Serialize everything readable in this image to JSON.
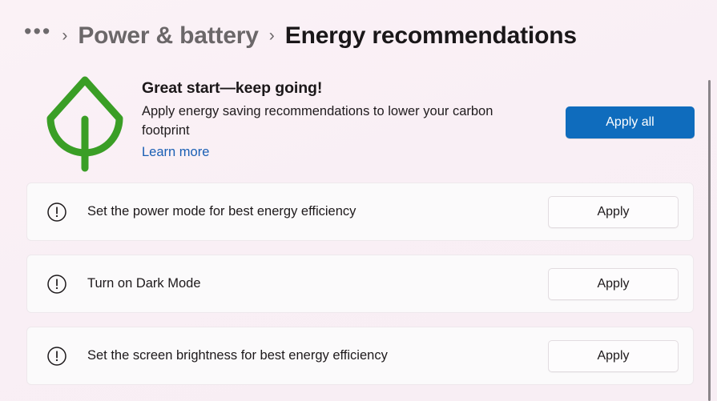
{
  "breadcrumb": {
    "overflow_label": "•••",
    "separator": "›",
    "parent_label": "Power & battery",
    "current_label": "Energy recommendations"
  },
  "hero": {
    "icon": "leaf-icon",
    "icon_color": "#3a9e26",
    "title": "Great start—keep going!",
    "description": "Apply energy saving recommendations to lower your carbon footprint",
    "link_label": "Learn more",
    "link_color": "#1a5fb4",
    "apply_all_label": "Apply all",
    "apply_all_color": "#0f6cbd"
  },
  "recommendations": [
    {
      "icon": "exclamation-circle-icon",
      "label": "Set the power mode for best energy efficiency",
      "action_label": "Apply"
    },
    {
      "icon": "exclamation-circle-icon",
      "label": "Turn on Dark Mode",
      "action_label": "Apply"
    },
    {
      "icon": "exclamation-circle-icon",
      "label": "Set the screen brightness for best energy efficiency",
      "action_label": "Apply"
    }
  ],
  "colors": {
    "page_background": "#f9f0f6",
    "card_background": "#fbfafb",
    "accent": "#0f6cbd",
    "leaf_green": "#3a9e26",
    "text_primary": "#1d191b",
    "text_muted": "#6b6769"
  }
}
